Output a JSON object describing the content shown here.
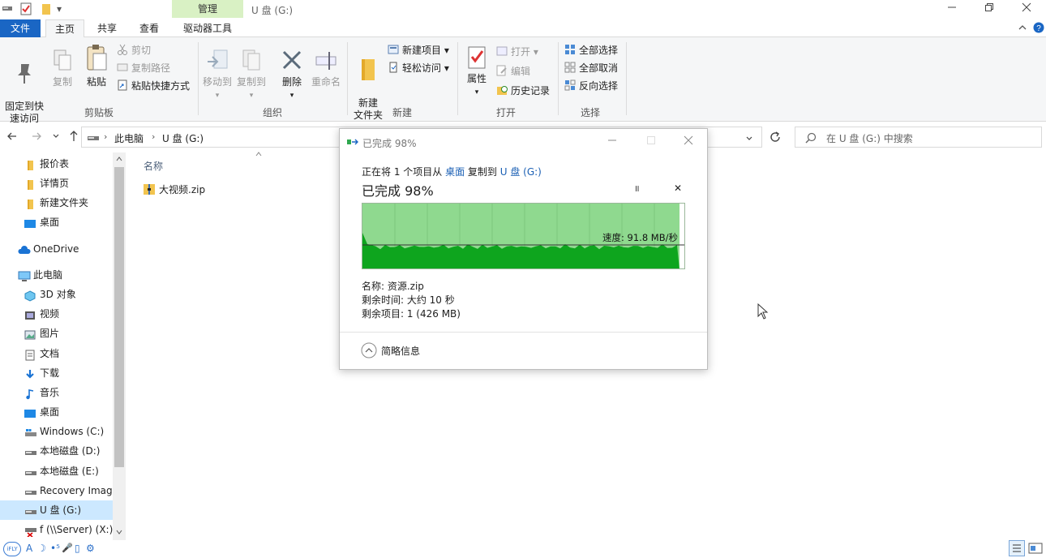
{
  "titlebar": {
    "context_tab": "管理",
    "window_title": "U 盘 (G:)",
    "qa_dropdown": "▾"
  },
  "tabs": {
    "file": "文件",
    "home": "主页",
    "share": "共享",
    "view": "查看",
    "drive_tools": "驱动器工具"
  },
  "ribbon": {
    "clipboard": {
      "pin": "固定到快\n速访问",
      "copy": "复制",
      "paste": "粘贴",
      "cut": "剪切",
      "copy_path": "复制路径",
      "paste_shortcut": "粘贴快捷方式",
      "label": "剪贴板"
    },
    "organize": {
      "move_to": "移动到",
      "copy_to": "复制到",
      "delete": "删除",
      "rename": "重命名",
      "label": "组织"
    },
    "new": {
      "new_folder": "新建\n文件夹",
      "new_item": "新建项目",
      "easy_access": "轻松访问",
      "label": "新建"
    },
    "open": {
      "properties": "属性",
      "open": "打开",
      "edit": "编辑",
      "history": "历史记录",
      "label": "打开"
    },
    "select": {
      "select_all": "全部选择",
      "select_none": "全部取消",
      "invert": "反向选择",
      "label": "选择"
    }
  },
  "address": {
    "crumb_pc": "此电脑",
    "crumb_drive": "U 盘 (G:)",
    "search_placeholder": "在 U 盘 (G:) 中搜索"
  },
  "nav": {
    "items": [
      {
        "label": "报价表"
      },
      {
        "label": "详情页"
      },
      {
        "label": "新建文件夹"
      },
      {
        "label": "桌面"
      },
      {
        "label": "OneDrive"
      },
      {
        "label": "此电脑"
      },
      {
        "label": "3D 对象"
      },
      {
        "label": "视频"
      },
      {
        "label": "图片"
      },
      {
        "label": "文档"
      },
      {
        "label": "下载"
      },
      {
        "label": "音乐"
      },
      {
        "label": "桌面"
      },
      {
        "label": "Windows (C:)"
      },
      {
        "label": "本地磁盘 (D:)"
      },
      {
        "label": "本地磁盘 (E:)"
      },
      {
        "label": "Recovery Image"
      },
      {
        "label": "U 盘 (G:)"
      },
      {
        "label": "f (\\\\Server) (X:)"
      }
    ]
  },
  "files": {
    "column_name": "名称",
    "items": [
      {
        "name": "大视频.zip"
      }
    ]
  },
  "dialog": {
    "title": "已完成 98%",
    "line_prefix": "正在将 1 个项目从 ",
    "source": "桌面",
    "line_mid": " 复制到 ",
    "dest": "U 盘 (G:)",
    "progress_text": "已完成 98%",
    "progress_fraction": 0.98,
    "speed": "速度: 91.8 MB/秒",
    "name": "名称: 资源.zip",
    "time_left": "剩余时间: 大约 10 秒",
    "items_left": "剩余项目: 1 (426 MB)",
    "details_toggle": "简略信息",
    "pause_glyph": "॥",
    "close_glyph": "✕"
  },
  "statusbar": {
    "ime_logo": "iFLY",
    "ime_items": [
      "A",
      "☽",
      "•⁵",
      "🎤",
      "▯",
      "⚙"
    ]
  },
  "colors": {
    "accent": "#1a66c4",
    "context_tab": "#d9f1c4",
    "selection": "#cce8ff",
    "graph_light": "#8fd98f",
    "graph_dark": "#0ea51e"
  }
}
